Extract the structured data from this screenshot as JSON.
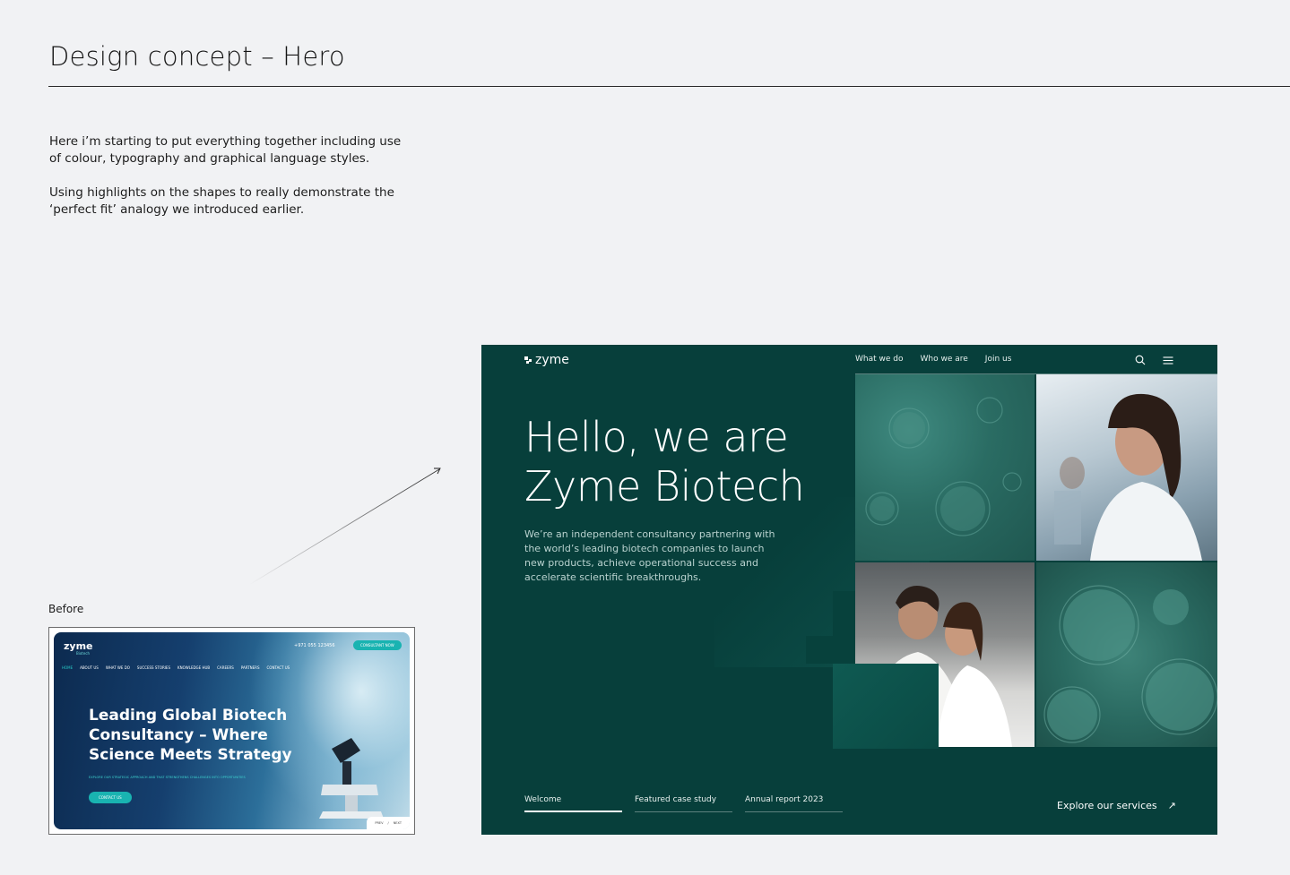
{
  "page": {
    "title": "Design concept – Hero",
    "intro": [
      "Here i’m starting to put everything together including use of colour, typography and graphical language styles.",
      "Using highlights on the shapes to really demonstrate the ‘perfect fit’ analogy we introduced earlier."
    ],
    "before_label": "Before"
  },
  "before": {
    "logo": "zyme",
    "logo_sub": "Biotech",
    "phone": "+971 055 123456",
    "cta_top": "CONSULTANT NOW",
    "nav": [
      "HOME",
      "ABOUT US",
      "WHAT WE DO",
      "SUCCESS STORIES",
      "KNOWLEDGE HUB",
      "CAREERS",
      "PARTNERS",
      "CONTACT US"
    ],
    "headline": "Leading Global Biotech Consultancy – Where Science Meets Strategy",
    "sub": "EXPLORE OUR STRATEGIC APPROACH AND THAT STRENGTHENS CHALLENGES INTO OPPORTUNITIES",
    "contact_button": "CONTACT US",
    "pager_prev": "PREV",
    "pager_sep": "/",
    "pager_next": "NEXT"
  },
  "hero": {
    "logo": "zyme",
    "nav": [
      "What we do",
      "Who we are",
      "Join us"
    ],
    "headline_line1": "Hello, we are",
    "headline_line2": "Zyme Biotech",
    "description": "We’re an independent consultancy partnering with the world’s leading biotech companies to launch new products, achieve operational success and accelerate scientific breakthroughs.",
    "tabs": [
      "Welcome",
      "Featured case study",
      "Annual report 2023"
    ],
    "explore": "Explore our services",
    "explore_icon": "↗",
    "colors": {
      "background": "#073f3b",
      "text": "#ffffff",
      "muted": "#b9d2cf"
    }
  }
}
